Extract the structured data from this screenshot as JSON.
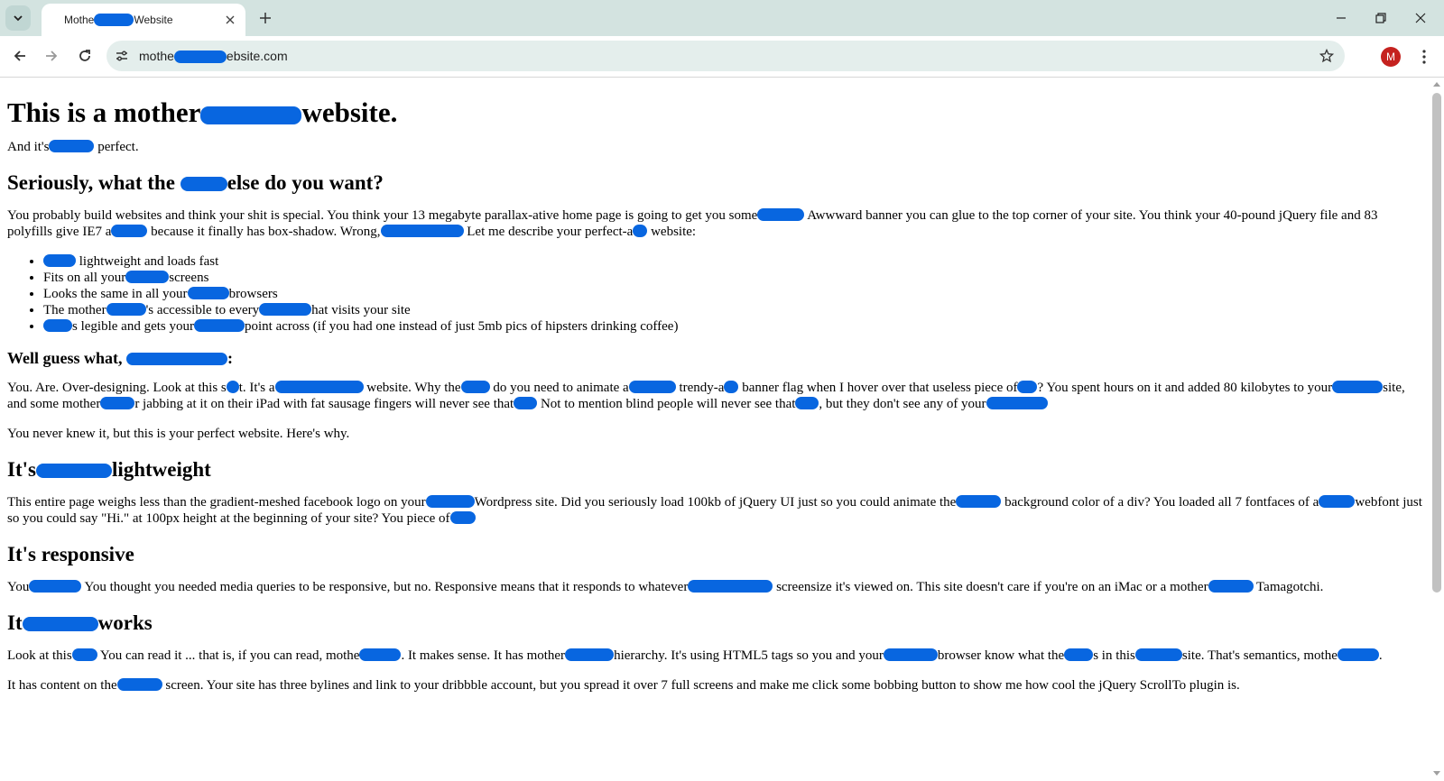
{
  "browser": {
    "tab_title_a": "Mothe",
    "tab_title_b": "Website",
    "url_a": "mothe",
    "url_b": "ebsite.com",
    "profile_initial": "M",
    "icons": [
      "tab-search-icon",
      "close-icon",
      "plus-icon",
      "minimize-icon",
      "restore-icon",
      "window-close-icon",
      "back-arrow-icon",
      "forward-arrow-icon",
      "reload-icon",
      "site-info-icon",
      "star-icon",
      "kebab-menu-icon"
    ]
  },
  "colors": {
    "redaction": "#0866e0",
    "tabbar": "#d3e3e0",
    "omnibox": "#e4eeec",
    "avatar": "#c5221f"
  },
  "content": {
    "h1_a": "This is a mother",
    "h1_b": "website.",
    "p1_a": "And it's",
    "p1_b": " perfect.",
    "h2_1_a": "Seriously, what the ",
    "h2_1_b": "else do you want?",
    "p2_a": "You probably build websites and think your shit is special. You think your 13 megabyte parallax-ative home page is going to get you some",
    "p2_b": " Awwward banner you can glue to the top corner of your site. You think your 40-pound jQuery file and 83 polyfills give IE7 a",
    "p2_c": " because it finally has box-shadow. Wrong,",
    "p2_d": " Let me describe your perfect-a",
    "p2_e": " website:",
    "li1_b": " lightweight and loads fast",
    "li2_a": "Fits on all your",
    "li2_b": "screens",
    "li3_a": "Looks the same in all your",
    "li3_b": "browsers",
    "li4_a": "The mother",
    "li4_b": "'s accessible to every",
    "li4_c": "hat visits your site",
    "li5_b": "s legible and gets your",
    "li5_c": "point across (if you had one instead of just 5mb pics of hipsters drinking coffee)",
    "h3_a": "Well guess what, ",
    "h3_b": ":",
    "p3_a": "You. Are. Over-designing. Look at this s",
    "p3_b": "t. It's a",
    "p3_c": " website. Why the",
    "p3_d": " do you need to animate a",
    "p3_e": " trendy-a",
    "p3_f": " banner flag when I hover over that useless piece of",
    "p3_g": "? You spent hours on it and added 80 kilobytes to your",
    "p3_h": "site, and some mother",
    "p3_i": "r jabbing at it on their iPad with fat sausage fingers will never see that",
    "p3_j": " Not to mention blind people will never see that",
    "p3_k": ", but they don't see any of your",
    "p4": "You never knew it, but this is your perfect website. Here's why.",
    "h2_2_a": "It's",
    "h2_2_b": "lightweight",
    "p5_a": "This entire page weighs less than the gradient-meshed facebook logo on your",
    "p5_b": "Wordpress site. Did you seriously load 100kb of jQuery UI just so you could animate the",
    "p5_c": " background color of a div? You loaded all 7 fontfaces of a",
    "p5_d": "webfont just so you could say \"Hi.\" at 100px height at the beginning of your site? You piece of",
    "h2_3": "It's responsive",
    "p6_a": "You",
    "p6_b": " You thought you needed media queries to be responsive, but no. Responsive means that it responds to whatever",
    "p6_c": " screensize it's viewed on. This site doesn't care if you're on an iMac or a mother",
    "p6_d": " Tamagotchi.",
    "h2_4_a": "It",
    "h2_4_b": "works",
    "p7_a": "Look at this",
    "p7_b": " You can read it ... that is, if you can read, mothe",
    "p7_c": ". It makes sense. It has mother",
    "p7_d": "hierarchy. It's using HTML5 tags so you and your",
    "p7_e": "browser know what the",
    "p7_f": "s in this",
    "p7_g": "site. That's semantics, mothe",
    "p7_h": ".",
    "p8_a": "It has content on the",
    "p8_b": " screen. Your site has three bylines and link to your dribbble account, but you spread it over 7 full screens and make me click some bobbing button to show me how cool the jQuery ScrollTo plugin is."
  }
}
